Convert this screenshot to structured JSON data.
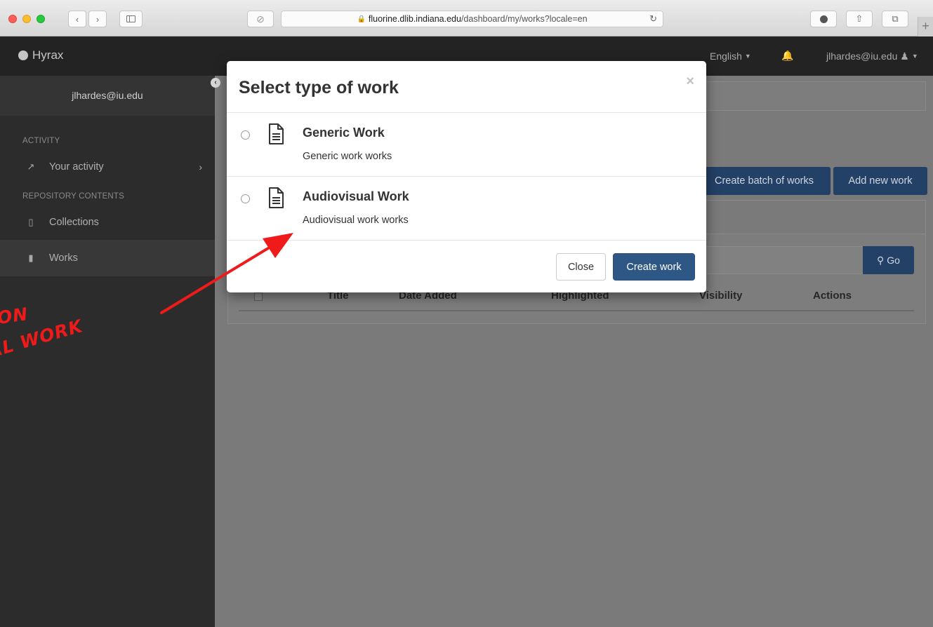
{
  "browser": {
    "url_domain": "fluorine.dlib.indiana.edu",
    "url_path": "/dashboard/my/works?locale=en"
  },
  "navbar": {
    "brand": "Hyrax",
    "language": "English",
    "user": "jlhardes@iu.edu"
  },
  "sidebar": {
    "user": "jlhardes@iu.edu",
    "sections": {
      "activity": "ACTIVITY",
      "repository": "REPOSITORY CONTENTS"
    },
    "items": [
      {
        "label": "Your activity",
        "icon": "line-chart-icon"
      },
      {
        "label": "Collections",
        "icon": "folder-open-icon"
      },
      {
        "label": "Works",
        "icon": "file-icon"
      }
    ]
  },
  "main": {
    "buttons": {
      "create_batch": "Create batch of works",
      "add_new": "Add new work",
      "go": "Go"
    },
    "table_headers": [
      "Title",
      "Date Added",
      "Highlighted",
      "Visibility",
      "Actions"
    ]
  },
  "modal": {
    "title": "Select type of work",
    "close_x": "×",
    "options": [
      {
        "title": "Generic Work",
        "description": "Generic work works",
        "icon": "document-icon"
      },
      {
        "title": "Audiovisual Work",
        "description": "Audiovisual work works",
        "icon": "document-icon"
      }
    ],
    "footer": {
      "close": "Close",
      "create": "Create work"
    }
  },
  "annotation": {
    "line1": "ON",
    "line2": "AL WORK",
    "color": "#ef1b1b"
  },
  "colors": {
    "primary": "#2e5786",
    "navbar": "#232323",
    "sidebar": "#2c2c2c"
  }
}
